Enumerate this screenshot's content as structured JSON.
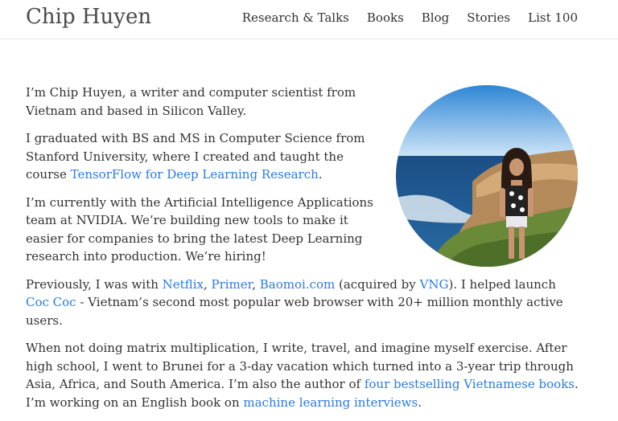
{
  "site": {
    "title": "Chip Huyen"
  },
  "nav": {
    "items": [
      "Research & Talks",
      "Books",
      "Blog",
      "Stories",
      "List 100"
    ]
  },
  "intro": {
    "p1": "I’m Chip Huyen, a writer and computer scientist from Vietnam and based in Silicon Valley.",
    "p2_pre": "I graduated with BS and MS in Computer Science from Stanford University, where I created and taught the course ",
    "p2_link": "TensorFlow for Deep Learning Research",
    "p2_post": ".",
    "p3": "I’m currently with the Artificial Intelligence Applications team at NVIDIA. We’re building new tools to make it easier for companies to bring the latest Deep Learning research into production. We’re hiring!",
    "p4_a": "Previously, I was with ",
    "p4_netflix": "Netflix",
    "p4_sep1": ", ",
    "p4_primer": "Primer",
    "p4_sep2": ", ",
    "p4_baomoi": "Baomoi.com",
    "p4_b": " (acquired by ",
    "p4_vng": "VNG",
    "p4_c": "). I helped launch ",
    "p4_coccoc": "Coc Coc",
    "p4_d": " - Vietnam’s second most popular web browser with 20+ million monthly active users.",
    "p5_a": "When not doing matrix multiplication, I write, travel, and imagine myself exercise. After high school, I went to Brunei for a 3-day vacation which turned into a 3-year trip through Asia, Africa, and South America. I’m also the author of ",
    "p5_books": "four bestselling Vietnamese books",
    "p5_b": ". I’m working on an English book on ",
    "p5_ml": "machine learning interviews",
    "p5_c": "."
  },
  "colors": {
    "link": "#2a7ae2",
    "text": "#313131"
  }
}
